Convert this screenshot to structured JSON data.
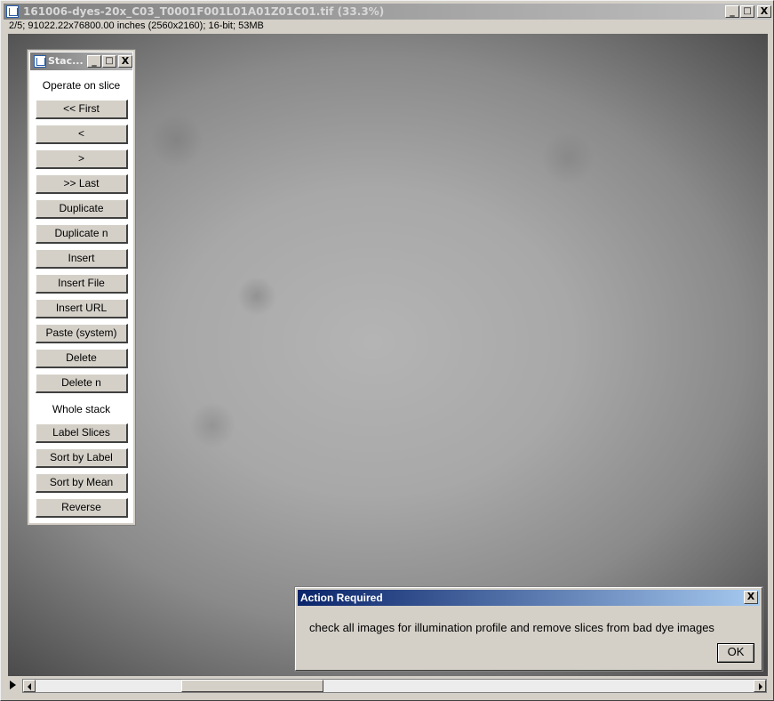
{
  "main_window": {
    "title": "161006-dyes-20x_C03_T0001F001L01A01Z01C01.tif (33.3%)",
    "info": "2/5; 91022.22x76800.00 inches (2560x2160); 16-bit; 53MB",
    "caption_buttons": {
      "minimize": "_",
      "maximize": "□",
      "close": "X"
    }
  },
  "stacks_panel": {
    "title": "Stac...",
    "caption_buttons": {
      "minimize": "_",
      "maximize": "□",
      "close": "X"
    },
    "section_slice": "Operate on slice",
    "slice_buttons": [
      "<< First",
      "<",
      ">",
      ">> Last",
      "Duplicate",
      "Duplicate n",
      "Insert",
      "Insert File",
      "Insert URL",
      "Paste (system)",
      "Delete",
      "Delete n"
    ],
    "section_stack": "Whole stack",
    "stack_buttons": [
      "Label Slices",
      "Sort by Label",
      "Sort by Mean",
      "Reverse"
    ]
  },
  "dialog": {
    "title": "Action Required",
    "close": "X",
    "message": "check all images for illumination profile and remove slices from bad dye images",
    "ok_label": "OK"
  },
  "scrollbar": {
    "icons": [
      "play-icon",
      "arrow-left-icon",
      "arrow-right-icon"
    ]
  }
}
